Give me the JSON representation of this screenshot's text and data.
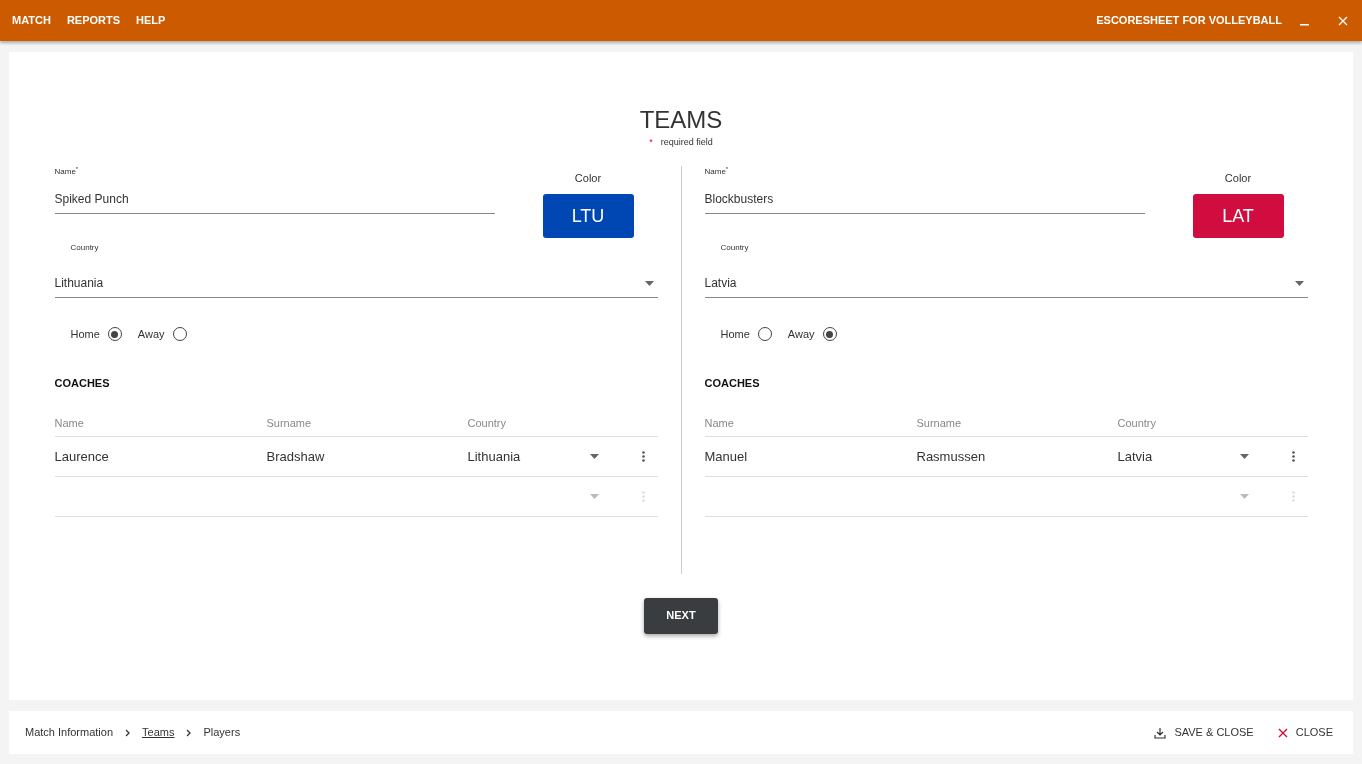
{
  "menu": [
    {
      "label": "MATCH"
    },
    {
      "label": "REPORTS"
    },
    {
      "label": "HELP"
    }
  ],
  "app_title": "ESCORESHEET FOR VOLLEYBALL",
  "page_title": "TEAMS",
  "required_mark": "*",
  "required_text": "required field",
  "teams": [
    {
      "name_label": "Name$^{*}$",
      "name": "Spiked Punch",
      "color_label": "Color",
      "color_code": "LTU",
      "color": "#0047b3",
      "country_label": "Country",
      "country": "Lithuania",
      "sides": [
        {
          "label": "Home",
          "selected": true
        },
        {
          "label": "Away",
          "selected": false
        }
      ],
      "coaches_title": "COACHES",
      "columns": [
        "Name",
        "Surname",
        "Country"
      ],
      "coaches": [
        {
          "kind": "filled",
          "name": "Laurence",
          "surname": "Bradshaw",
          "country": "Lithuania"
        },
        {
          "kind": "blank"
        }
      ]
    },
    {
      "name_label": "Name$^{*}$",
      "name": "Blockbusters",
      "color_label": "Color",
      "color_code": "LAT",
      "color": "#d10c3f",
      "country_label": "Country",
      "country": "Latvia",
      "sides": [
        {
          "label": "Home",
          "selected": false
        },
        {
          "label": "Away",
          "selected": true
        }
      ],
      "coaches_title": "COACHES",
      "columns": [
        "Name",
        "Surname",
        "Country"
      ],
      "coaches": [
        {
          "kind": "filled",
          "name": "Manuel",
          "surname": "Rasmussen",
          "country": "Latvia"
        },
        {
          "kind": "blank"
        }
      ]
    }
  ],
  "next_button": "NEXT",
  "breadcrumbs": [
    {
      "label": "Match Information",
      "selected": false
    },
    {
      "label": "Teams",
      "selected": true
    },
    {
      "label": "Players",
      "selected": false
    }
  ],
  "actions": [
    {
      "kind": "save",
      "label": "SAVE & CLOSE"
    },
    {
      "kind": "close",
      "label": "CLOSE"
    }
  ]
}
